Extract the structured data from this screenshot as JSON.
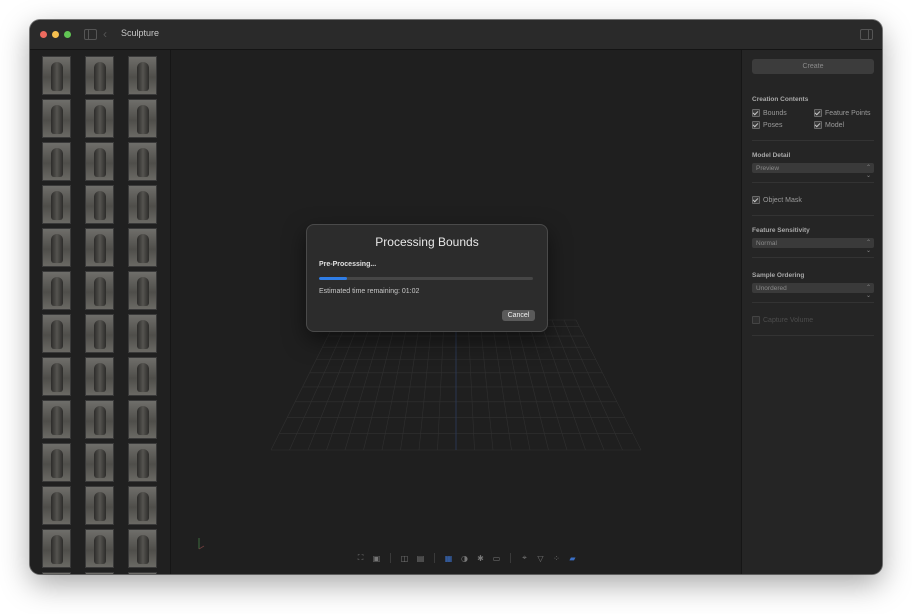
{
  "window": {
    "title": "Sculpture"
  },
  "thumbnails": {
    "count": 39
  },
  "modal": {
    "title": "Processing Bounds",
    "status": "Pre-Processing...",
    "progress": 0.13,
    "eta_text": "Estimated time remaining: 01:02",
    "cancel_label": "Cancel"
  },
  "inspector": {
    "create_label": "Create",
    "creation_contents": {
      "title": "Creation Contents",
      "bounds": "Bounds",
      "feature_points": "Feature Points",
      "poses": "Poses",
      "model": "Model"
    },
    "model_detail": {
      "title": "Model Detail",
      "value": "Preview"
    },
    "object_mask": "Object Mask",
    "feature_sensitivity": {
      "title": "Feature Sensitivity",
      "value": "Normal"
    },
    "sample_ordering": {
      "title": "Sample Ordering",
      "value": "Unordered"
    },
    "capture_volume": "Capture Volume"
  },
  "toolbar": {
    "icons": [
      "frame-icon",
      "bounds-icon",
      "camera-icon",
      "image-icon",
      "grid-icon",
      "contrast-icon",
      "light-icon",
      "rect-icon",
      "axis-icon",
      "filter-icon",
      "points-icon",
      "model-icon"
    ]
  },
  "colors": {
    "accent": "#2f7de6",
    "window_bg": "#1e1e1e",
    "panel_bg": "#252525"
  }
}
